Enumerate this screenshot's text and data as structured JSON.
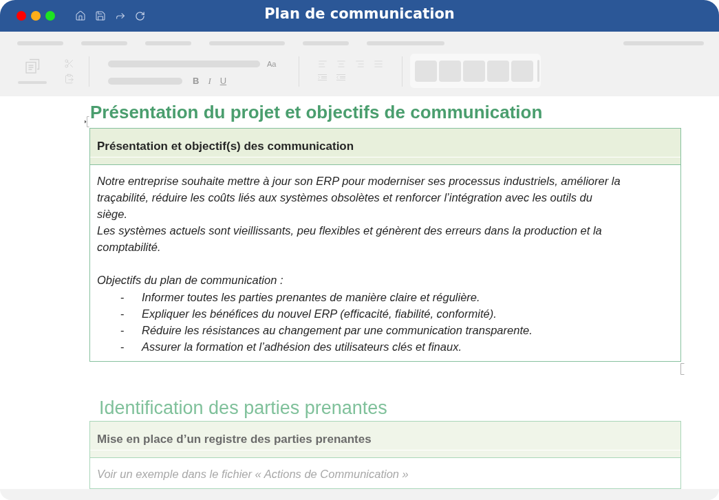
{
  "window": {
    "title": "Plan de communication",
    "controls": [
      {
        "color": "#ff0000"
      },
      {
        "color": "#ffae1a"
      },
      {
        "color": "#1de322"
      }
    ]
  },
  "ribbon": {
    "case_button": "Aa",
    "format_buttons": [
      {
        "kind": "bold",
        "label": "B"
      },
      {
        "kind": "italic",
        "label": "I"
      },
      {
        "kind": "underline",
        "label": "U"
      }
    ]
  },
  "document": {
    "sections": [
      {
        "dimmed": false,
        "heading": {
          "kind": "heading1",
          "text": "Présentation du projet et objectifs de communication"
        },
        "table": {
          "selected": true,
          "header": "Présentation et objectif(s) des communication",
          "body": [
            {
              "kind": "paragraph",
              "lines": [
                "Notre entreprise souhaite mettre à jour son ERP pour moderniser ses processus industriels, améliorer la",
                "traçabilité, réduire les coûts liés aux systèmes obsolètes et renforcer l’intégration avec les outils du",
                "siège."
              ]
            },
            {
              "kind": "paragraph",
              "lines": [
                "Les systèmes actuels sont vieillissants, peu flexibles et génèrent des erreurs dans la production et la",
                "comptabilité."
              ]
            },
            {
              "kind": "list",
              "title": "Objectifs du plan de communication :",
              "items": [
                {
                  "marker": "-",
                  "text": "Informer toutes les parties prenantes de manière claire et régulière."
                },
                {
                  "marker": "-",
                  "text": "Expliquer les bénéfices du nouvel ERP (efficacité, fiabilité, conformité)."
                },
                {
                  "marker": "-",
                  "text": "Réduire les résistances au changement par une communication transparente."
                },
                {
                  "marker": "-",
                  "text": "Assurer la formation et l’adhésion des utilisateurs clés et finaux."
                }
              ]
            }
          ]
        }
      },
      {
        "dimmed": true,
        "heading": {
          "kind": "heading2",
          "text": "Identification des parties prenantes"
        },
        "table": {
          "selected": false,
          "header": "Mise en place d’un registre des parties prenantes",
          "body": [
            {
              "kind": "paragraph",
              "lines": [
                "Voir un exemple dans le fichier « Actions de Communication »"
              ]
            }
          ]
        }
      }
    ]
  }
}
